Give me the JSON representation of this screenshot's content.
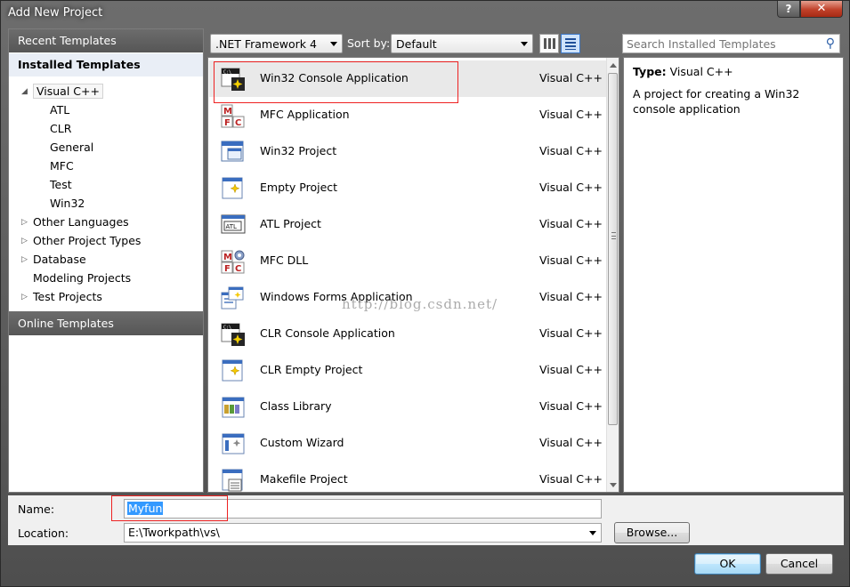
{
  "window": {
    "title": "Add New Project",
    "help_label": "?",
    "close_label": "✕"
  },
  "left_panel": {
    "recent_label": "Recent Templates",
    "installed_label": "Installed Templates",
    "online_label": "Online Templates",
    "tree": {
      "visual_cpp": "Visual C++",
      "children": [
        "ATL",
        "CLR",
        "General",
        "MFC",
        "Test",
        "Win32"
      ],
      "other_languages": "Other Languages",
      "other_project_types": "Other Project Types",
      "database": "Database",
      "modeling_projects": "Modeling Projects",
      "test_projects": "Test Projects"
    }
  },
  "toolbar": {
    "framework": ".NET Framework 4",
    "sortby_label": "Sort by:",
    "sortby_value": "Default",
    "search_placeholder": "Search Installed Templates"
  },
  "templates": [
    {
      "name": "Win32 Console Application",
      "lang": "Visual C++",
      "icon": "console-app-icon"
    },
    {
      "name": "MFC Application",
      "lang": "Visual C++",
      "icon": "mfc-icon"
    },
    {
      "name": "Win32 Project",
      "lang": "Visual C++",
      "icon": "window-icon"
    },
    {
      "name": "Empty Project",
      "lang": "Visual C++",
      "icon": "empty-project-icon"
    },
    {
      "name": "ATL Project",
      "lang": "Visual C++",
      "icon": "atl-icon"
    },
    {
      "name": "MFC DLL",
      "lang": "Visual C++",
      "icon": "mfc-dll-icon"
    },
    {
      "name": "Windows Forms Application",
      "lang": "Visual C++",
      "icon": "forms-icon"
    },
    {
      "name": "CLR Console Application",
      "lang": "Visual C++",
      "icon": "console-app-icon"
    },
    {
      "name": "CLR Empty Project",
      "lang": "Visual C++",
      "icon": "empty-project-icon"
    },
    {
      "name": "Class Library",
      "lang": "Visual C++",
      "icon": "class-library-icon"
    },
    {
      "name": "Custom Wizard",
      "lang": "Visual C++",
      "icon": "wizard-icon"
    },
    {
      "name": "Makefile Project",
      "lang": "Visual C++",
      "icon": "makefile-icon"
    }
  ],
  "description": {
    "type_label": "Type:",
    "type_value": "Visual C++",
    "text": "A project for creating a Win32 console application"
  },
  "watermark": "http://blog.csdn.net/",
  "form": {
    "name_label": "Name:",
    "name_value": "Myfun",
    "location_label": "Location:",
    "location_value": "E:\\Tworkpath\\vs\\",
    "browse_label": "Browse..."
  },
  "buttons": {
    "ok": "OK",
    "cancel": "Cancel"
  },
  "colors": {
    "accent": "#3399ff",
    "highlight_box": "#e22222",
    "chrome": "#5a5a5a"
  }
}
